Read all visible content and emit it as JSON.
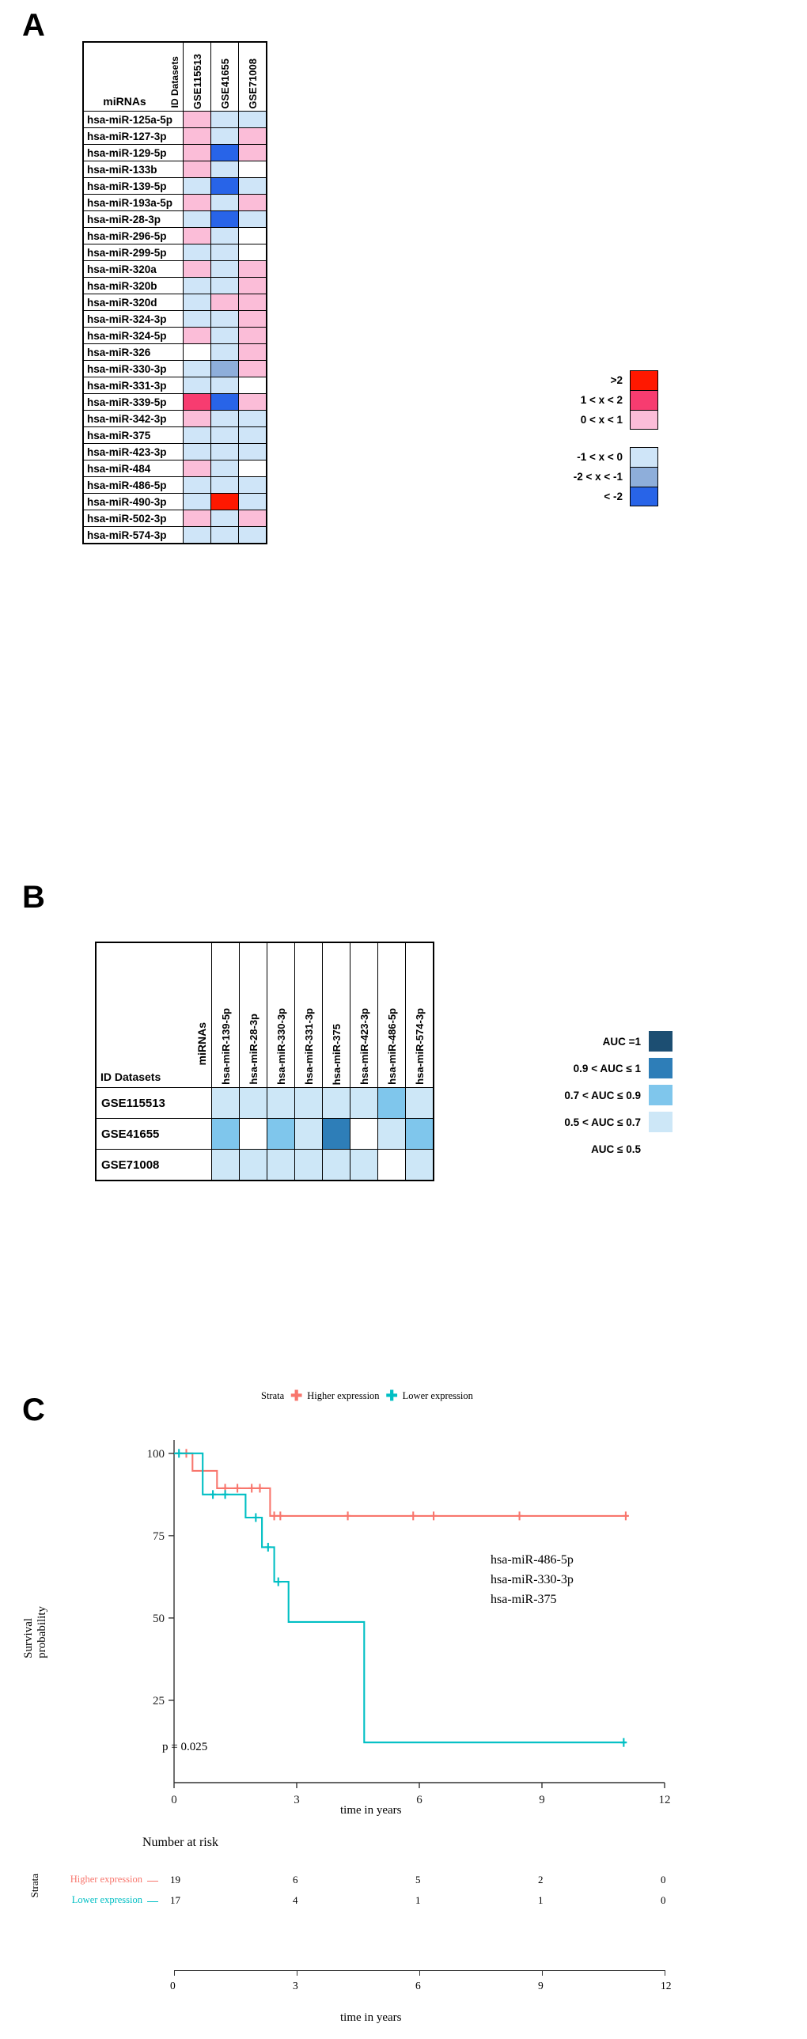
{
  "panels": {
    "a_letter": "A",
    "b_letter": "B",
    "c_letter": "C"
  },
  "panelA": {
    "corner_mirna_label": "miRNAs",
    "corner_id_label": "ID Datasets",
    "datasets": [
      "GSE115513",
      "GSE41655",
      "GSE71008"
    ],
    "rows": [
      {
        "mirna": "hsa-miR-125a-5p",
        "cells": [
          "pink",
          "lblue",
          "lblue"
        ]
      },
      {
        "mirna": "hsa-miR-127-3p",
        "cells": [
          "pink",
          "lblue",
          "pink"
        ]
      },
      {
        "mirna": "hsa-miR-129-5p",
        "cells": [
          "pink",
          "blue",
          "pink"
        ]
      },
      {
        "mirna": "hsa-miR-133b",
        "cells": [
          "pink",
          "lblue",
          "white"
        ]
      },
      {
        "mirna": "hsa-miR-139-5p",
        "cells": [
          "lblue",
          "blue",
          "lblue"
        ]
      },
      {
        "mirna": "hsa-miR-193a-5p",
        "cells": [
          "pink",
          "lblue",
          "pink"
        ]
      },
      {
        "mirna": "hsa-miR-28-3p",
        "cells": [
          "lblue",
          "blue",
          "lblue"
        ]
      },
      {
        "mirna": "hsa-miR-296-5p",
        "cells": [
          "pink",
          "lblue",
          "white"
        ]
      },
      {
        "mirna": "hsa-miR-299-5p",
        "cells": [
          "lblue",
          "lblue",
          "white"
        ]
      },
      {
        "mirna": "hsa-miR-320a",
        "cells": [
          "pink",
          "lblue",
          "pink"
        ]
      },
      {
        "mirna": "hsa-miR-320b",
        "cells": [
          "lblue",
          "lblue",
          "pink"
        ]
      },
      {
        "mirna": "hsa-miR-320d",
        "cells": [
          "lblue",
          "pink",
          "pink"
        ]
      },
      {
        "mirna": "hsa-miR-324-3p",
        "cells": [
          "lblue",
          "lblue",
          "pink"
        ]
      },
      {
        "mirna": "hsa-miR-324-5p",
        "cells": [
          "pink",
          "lblue",
          "pink"
        ]
      },
      {
        "mirna": "hsa-miR-326",
        "cells": [
          "white",
          "lblue",
          "pink"
        ]
      },
      {
        "mirna": "hsa-miR-330-3p",
        "cells": [
          "lblue",
          "mblue",
          "pink"
        ]
      },
      {
        "mirna": "hsa-miR-331-3p",
        "cells": [
          "lblue",
          "lblue",
          "white"
        ]
      },
      {
        "mirna": "hsa-miR-339-5p",
        "cells": [
          "magenta",
          "blue",
          "pink"
        ]
      },
      {
        "mirna": "hsa-miR-342-3p",
        "cells": [
          "pink",
          "lblue",
          "lblue"
        ]
      },
      {
        "mirna": "hsa-miR-375",
        "cells": [
          "lblue",
          "lblue",
          "lblue"
        ]
      },
      {
        "mirna": "hsa-miR-423-3p",
        "cells": [
          "lblue",
          "lblue",
          "lblue"
        ]
      },
      {
        "mirna": "hsa-miR-484",
        "cells": [
          "pink",
          "lblue",
          "white"
        ]
      },
      {
        "mirna": "hsa-miR-486-5p",
        "cells": [
          "lblue",
          "lblue",
          "lblue"
        ]
      },
      {
        "mirna": "hsa-miR-490-3p",
        "cells": [
          "lblue",
          "red",
          "lblue"
        ]
      },
      {
        "mirna": "hsa-miR-502-3p",
        "cells": [
          "pink",
          "lblue",
          "pink"
        ]
      },
      {
        "mirna": "hsa-miR-574-3p",
        "cells": [
          "lblue",
          "lblue",
          "lblue"
        ]
      }
    ],
    "legend_high": [
      {
        "label": ">2",
        "color": "red"
      },
      {
        "label": "1 < x < 2",
        "color": "magenta"
      },
      {
        "label": "0 < x < 1",
        "color": "pink"
      }
    ],
    "legend_low": [
      {
        "label": "-1 < x < 0",
        "color": "lblue"
      },
      {
        "label": "-2 < x < -1",
        "color": "mblue"
      },
      {
        "label": "< -2",
        "color": "blue"
      }
    ],
    "colors": {
      "red": "#FF1800",
      "magenta": "#F73C70",
      "pink": "#FBBDD8",
      "white": "#FFFFFF",
      "lblue": "#CFE5F8",
      "mblue": "#8EAEDA",
      "blue": "#2864E8"
    }
  },
  "panelB": {
    "corner_mirna_label": "miRNAs",
    "corner_id_label": "ID Datasets",
    "mirnas": [
      "hsa-miR-139-5p",
      "hsa-miR-28-3p",
      "hsa-miR-330-3p",
      "hsa-miR-331-3p",
      "hsa-miR-375",
      "hsa-miR-423-3p",
      "hsa-miR-486-5p",
      "hsa-miR-574-3p"
    ],
    "rows": [
      {
        "dataset": "GSE115513",
        "cells": [
          "b1",
          "b1",
          "b1",
          "b1",
          "b1",
          "b1",
          "b2",
          "b1"
        ]
      },
      {
        "dataset": "GSE41655",
        "cells": [
          "b2",
          "b0",
          "b2",
          "b1",
          "b3",
          "b0",
          "b1",
          "b2"
        ]
      },
      {
        "dataset": "GSE71008",
        "cells": [
          "b1",
          "b1",
          "b1",
          "b1",
          "b1",
          "b1",
          "b0",
          "b1"
        ]
      }
    ],
    "legend": [
      {
        "label": "AUC =1",
        "color": "b4"
      },
      {
        "label": "0.9 < AUC ≤ 1",
        "color": "b3"
      },
      {
        "label": "0.7 < AUC ≤ 0.9",
        "color": "b2"
      },
      {
        "label": "0.5 < AUC ≤ 0.7",
        "color": "b1"
      },
      {
        "label": "AUC ≤ 0.5",
        "color": "b0"
      }
    ],
    "colors": {
      "b0": "#FFFFFF",
      "b1": "#CDE7F7",
      "b2": "#7FC6EC",
      "b3": "#2E7EB8",
      "b4": "#1C4E72"
    }
  },
  "chart_data": {
    "type": "line",
    "title": "",
    "xlabel": "time in years",
    "ylabel": "Survival probability",
    "xlim": [
      0,
      12
    ],
    "ylim": [
      0,
      105
    ],
    "xticks": [
      0,
      3,
      6,
      9,
      12
    ],
    "yticks": [
      0,
      25,
      50,
      75,
      100
    ],
    "grid": false,
    "legend_title": "Strata",
    "legend_position": "top",
    "pvalue_text": "p = 0.025",
    "annotation_lines": [
      "hsa-miR-486-5p",
      "hsa-miR-330-3p",
      "hsa-miR-375"
    ],
    "colors": {
      "higher": "#F8766D",
      "lower": "#00BFC4"
    },
    "series": [
      {
        "name": "Higher expression",
        "color": "#F8766D",
        "steps": [
          [
            0.0,
            100
          ],
          [
            0.45,
            100
          ],
          [
            0.45,
            94.7
          ],
          [
            1.05,
            94.7
          ],
          [
            1.05,
            89.4
          ],
          [
            2.35,
            89.4
          ],
          [
            2.35,
            81.0
          ],
          [
            11.1,
            81.0
          ]
        ],
        "censor_points": [
          [
            0.3,
            100
          ],
          [
            1.25,
            89.4
          ],
          [
            1.55,
            89.4
          ],
          [
            1.9,
            89.4
          ],
          [
            2.1,
            89.4
          ],
          [
            2.45,
            81.0
          ],
          [
            2.6,
            81.0
          ],
          [
            4.25,
            81.0
          ],
          [
            5.85,
            81.0
          ],
          [
            6.35,
            81.0
          ],
          [
            8.45,
            81.0
          ],
          [
            11.05,
            81.0
          ]
        ]
      },
      {
        "name": "Lower expression",
        "color": "#00BFC4",
        "steps": [
          [
            0.0,
            100
          ],
          [
            0.7,
            100
          ],
          [
            0.7,
            87.5
          ],
          [
            1.75,
            87.5
          ],
          [
            1.75,
            80.5
          ],
          [
            2.15,
            80.5
          ],
          [
            2.15,
            71.5
          ],
          [
            2.45,
            71.5
          ],
          [
            2.45,
            61.0
          ],
          [
            2.8,
            61.0
          ],
          [
            2.8,
            48.8
          ],
          [
            4.65,
            48.8
          ],
          [
            4.65,
            12.2
          ],
          [
            11.05,
            12.2
          ]
        ],
        "censor_points": [
          [
            0.12,
            100
          ],
          [
            0.95,
            87.5
          ],
          [
            1.25,
            87.5
          ],
          [
            2.0,
            80.5
          ],
          [
            2.3,
            71.5
          ],
          [
            2.55,
            61.0
          ],
          [
            11.0,
            12.2
          ]
        ]
      }
    ],
    "risk_table": {
      "title": "Number at risk",
      "strata_axis_label": "Strata",
      "times": [
        0,
        3,
        6,
        9,
        12
      ],
      "rows": [
        {
          "label": "Higher expression",
          "color": "#F8766D",
          "counts": [
            19,
            6,
            5,
            2,
            0
          ]
        },
        {
          "label": "Lower expression",
          "color": "#00BFC4",
          "counts": [
            17,
            4,
            1,
            1,
            0
          ]
        }
      ],
      "xlabel": "time in years"
    }
  }
}
